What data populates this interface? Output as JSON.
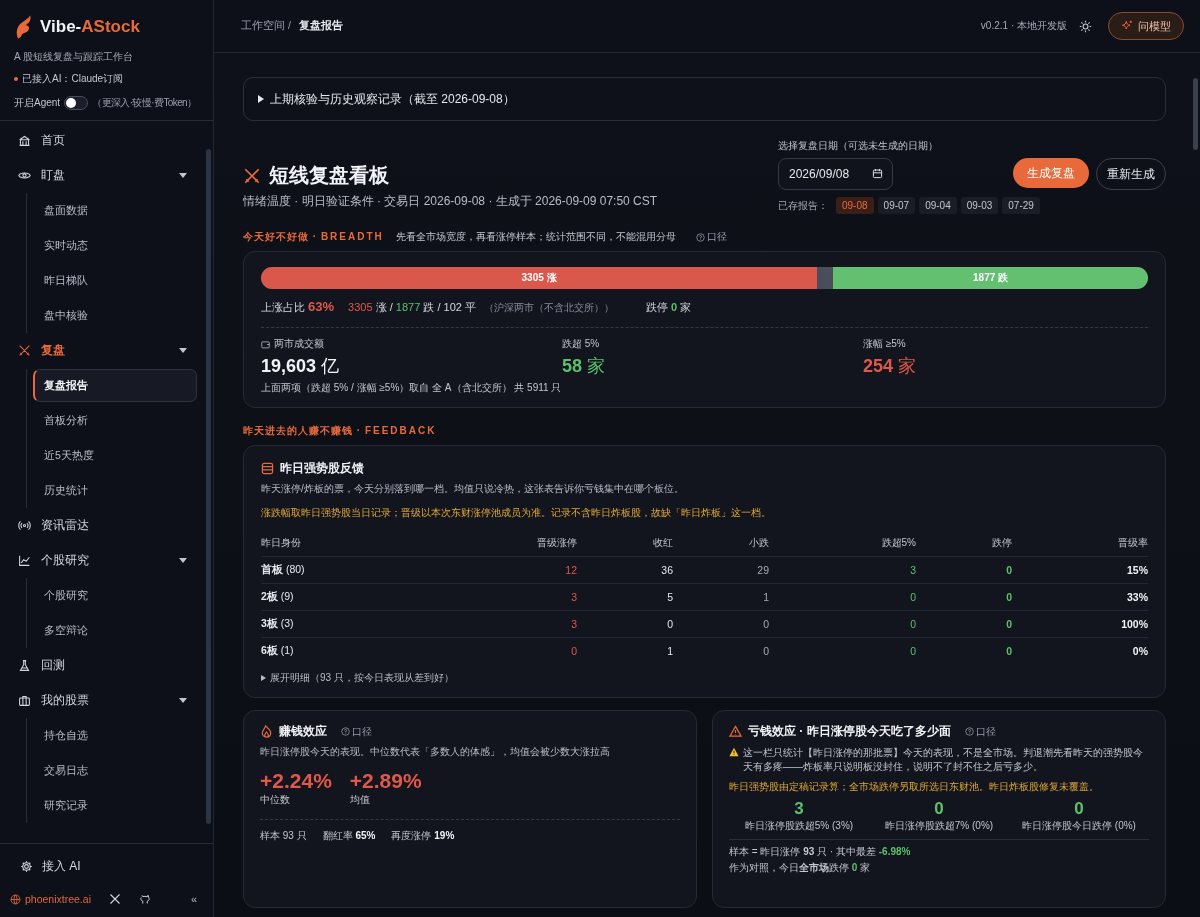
{
  "sidebar": {
    "brand_prefix": "Vibe-",
    "brand_suffix": "AStock",
    "tagline": "A 股短线复盘与跟踪工作台",
    "ai_status": "已接入AI：Claude订阅",
    "agent": {
      "label": "开启Agent",
      "on": false,
      "hint": "（更深入·较慢·费Token）"
    },
    "nav": [
      {
        "label": "首页",
        "selected": false
      },
      {
        "label": "盯盘",
        "selected": false,
        "expanded": true,
        "children": [
          {
            "label": "盘面数据",
            "selected": false
          },
          {
            "label": "实时动态",
            "selected": false
          },
          {
            "label": "昨日梯队",
            "selected": false
          },
          {
            "label": "盘中核验",
            "selected": false
          }
        ]
      },
      {
        "label": "复盘",
        "selected": true,
        "expanded": true,
        "children": [
          {
            "label": "复盘报告",
            "selected": true
          },
          {
            "label": "首板分析",
            "selected": false
          },
          {
            "label": "近5天热度",
            "selected": false
          },
          {
            "label": "历史统计",
            "selected": false
          }
        ]
      },
      {
        "label": "资讯雷达",
        "selected": false
      },
      {
        "label": "个股研究",
        "selected": false,
        "expanded": true,
        "children": [
          {
            "label": "个股研究",
            "selected": false
          },
          {
            "label": "多空辩论",
            "selected": false
          }
        ]
      },
      {
        "label": "回测",
        "selected": false
      },
      {
        "label": "我的股票",
        "selected": false,
        "expanded": true,
        "children": [
          {
            "label": "持仓自选",
            "selected": false
          },
          {
            "label": "交易日志",
            "selected": false
          },
          {
            "label": "研究记录",
            "selected": false
          }
        ]
      }
    ],
    "connect_ai": "接入 AI",
    "site": "phoenixtree.ai",
    "collapse": "«"
  },
  "header": {
    "breadcrumb": "工作空间 /",
    "current": "复盘报告",
    "version": "v0.2.1 · 本地开发版",
    "ask_button": "问模型"
  },
  "history_toggle": {
    "label": "上期核验与历史观察记录（截至 2026-09-08）",
    "expanded": false
  },
  "board": {
    "title": "短线复盘看板",
    "subtitle": "情绪温度 · 明日验证条件 · 交易日 2026-09-08 · 生成于 2026-09-09 07:50 CST",
    "date_label": "选择复盘日期（可选未生成的日期）",
    "date_value": "2026/09/08",
    "generate_button": "生成复盘",
    "regenerate_button": "重新生成",
    "saved_label": "已存报告：",
    "saved": [
      {
        "label": "09-08",
        "selected": true
      },
      {
        "label": "09-07",
        "selected": false
      },
      {
        "label": "09-04",
        "selected": false
      },
      {
        "label": "09-03",
        "selected": false
      },
      {
        "label": "07-29",
        "selected": false
      }
    ]
  },
  "breadth": {
    "section_title": "今天好不好做 ·",
    "section_en": "BREADTH",
    "section_note": "先看全市场宽度，再看涨停样本；统计范围不同，不能混用分母",
    "scope_link": "口径",
    "segments": [
      {
        "kind": "up",
        "label": "3305 涨",
        "level": 0.627
      },
      {
        "kind": "flat",
        "level": 0.018
      },
      {
        "kind": "down",
        "label": "1877 跌",
        "level": 0.355
      }
    ],
    "ratio_label": "上涨占比",
    "ratio": "63%",
    "up_count": "3305",
    "up_unit": "涨 /",
    "down_count": "1877",
    "down_unit": "跌 / 102 平",
    "scope": "（沪深两市（不含北交所））",
    "limit_down_label": "跌停",
    "limit_down": "0",
    "limit_down_unit": "家",
    "stats": [
      {
        "label": "两市成交额",
        "value": "19,603",
        "unit": "亿"
      },
      {
        "label": "跌超 5%",
        "value": "58",
        "unit": "家"
      },
      {
        "label": "涨幅 ≥5%",
        "value": "254",
        "unit": "家"
      }
    ],
    "footnote": "上面两项（跌超 5% / 涨幅 ≥5%）取自 全 A（含北交所） 共 5911 只"
  },
  "feedback": {
    "section_title": "昨天进去的人赚不赚钱 ·",
    "section_en": "FEEDBACK",
    "title": "昨日强势股反馈",
    "desc": "昨天涨停/炸板的票，今天分别落到哪一档。均值只说冷热，这张表告诉你亏钱集中在哪个板位。",
    "warning": "涨跌幅取昨日强势股当日记录；晋级以本次东财涨停池成员为准。记录不含昨日炸板股，故缺「昨日炸板」这一档。",
    "columns": [
      "昨日身份",
      "晋级涨停",
      "收红",
      "小跌",
      "跌超5%",
      "跌停",
      "晋级率"
    ],
    "rows": [
      {
        "cells": [
          "**首板** (80)",
          "12",
          "36",
          "29",
          "3",
          "0",
          "15%"
        ]
      },
      {
        "cells": [
          "**2板** (9)",
          "3",
          "5",
          "1",
          "0",
          "0",
          "33%"
        ]
      },
      {
        "cells": [
          "**3板** (3)",
          "3",
          "0",
          "0",
          "0",
          "0",
          "100%"
        ]
      },
      {
        "cells": [
          "**6板** (1)",
          "0",
          "1",
          "0",
          "0",
          "0",
          "0%"
        ]
      }
    ],
    "expand": {
      "label": "展开明细（93 只，按今日表现从差到好）",
      "expanded": false
    }
  },
  "profit": {
    "title": "赚钱效应",
    "scope_link": "口径",
    "desc": "昨日涨停股今天的表现。中位数代表「多数人的体感」，均值会被少数大涨拉高",
    "metrics": [
      {
        "value": "+2.24%",
        "label": "中位数"
      },
      {
        "value": "+2.89%",
        "label": "均值"
      }
    ],
    "stats": [
      "样本 93 只",
      "翻红率 **65%**",
      "再度涨停 **19%**"
    ]
  },
  "loss": {
    "title": "亏钱效应 · 昨日涨停股今天吃了多少面",
    "scope_link": "口径",
    "note": "这一栏只统计【昨日涨停的那批票】今天的表现，不是全市场。判退潮先看昨天的强势股今天有多疼——炸板率只说明板没封住，说明不了封不住之后亏多少。",
    "warning": "昨日强势股由定稿记录算；全市场跌停另取所选日东财池。昨日炸板股修复未覆盖。",
    "metrics": [
      {
        "value": "3",
        "label": "昨日涨停股跌超5% (3%)"
      },
      {
        "value": "0",
        "label": "昨日涨停股跌超7% (0%)"
      },
      {
        "value": "0",
        "label": "昨日涨停股今日跌停 (0%)"
      }
    ],
    "sample_prefix": "样本 = 昨日涨停 **93** 只 · 其中最差",
    "worst": "-6.98%",
    "contrast_prefix": "作为对照，今日**全市场**跌停",
    "contrast_count": "0",
    "contrast_unit": "家"
  }
}
